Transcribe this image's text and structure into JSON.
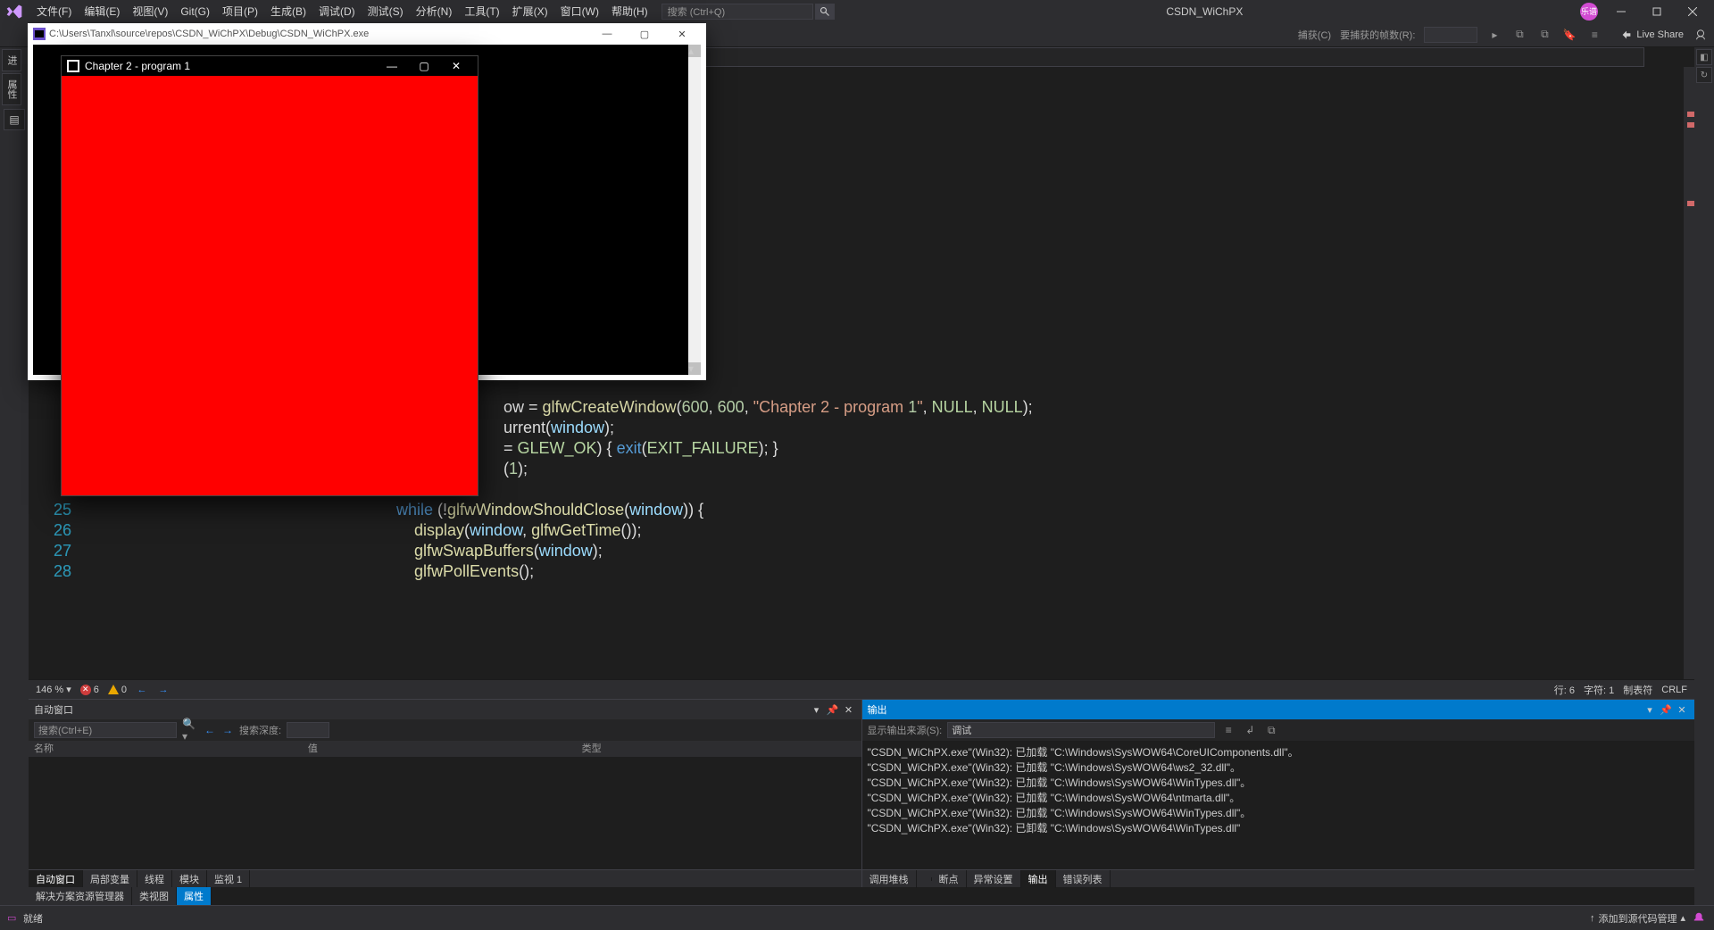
{
  "menubar": {
    "items": [
      "文件(F)",
      "编辑(E)",
      "视图(V)",
      "Git(G)",
      "项目(P)",
      "生成(B)",
      "调试(D)",
      "测试(S)",
      "分析(N)",
      "工具(T)",
      "扩展(X)",
      "窗口(W)",
      "帮助(H)"
    ],
    "search_placeholder": "搜索 (Ctrl+Q)",
    "title": "CSDN_WiChPX",
    "user_initial": "乐谱"
  },
  "toolbar": {
    "capture_label": "捕获(C)",
    "frames_label": "要捕获的帧数(R):",
    "frames_value": "",
    "liveshare": "Live Share"
  },
  "left_rail": {
    "tabs": [
      "进",
      "属性"
    ]
  },
  "editor": {
    "gutter_start": 25,
    "lines": [
      {
        "n": "",
        "raw": "ow = glfwCreateWindow(600, 600, \"Chapter 2 - program 1\", NULL, NULL);"
      },
      {
        "n": "",
        "raw": "urrent(window);"
      },
      {
        "n": "",
        "raw": "= GLEW_OK) { exit(EXIT_FAILURE); }"
      },
      {
        "n": "",
        "raw": "(1);"
      },
      {
        "n": "",
        "raw": ""
      },
      {
        "n": 25,
        "raw": "while (!glfwWindowShouldClose(window)) {"
      },
      {
        "n": 26,
        "raw": "    display(window, glfwGetTime());"
      },
      {
        "n": 27,
        "raw": "    glfwSwapBuffers(window);"
      },
      {
        "n": 28,
        "raw": "    glfwPollEvents();"
      }
    ],
    "status": {
      "zoom": "146 %",
      "errors": "6",
      "warnings": "0",
      "line": "行: 6",
      "col": "字符: 1",
      "tab": "制表符",
      "eol": "CRLF"
    }
  },
  "autos": {
    "title": "自动窗口",
    "search_placeholder": "搜索(Ctrl+E)",
    "depth_label": "搜索深度:",
    "cols": [
      "名称",
      "值",
      "类型"
    ],
    "tabs": [
      "自动窗口",
      "局部变量",
      "线程",
      "模块",
      "监视 1"
    ]
  },
  "output": {
    "title": "输出",
    "src_label": "显示输出来源(S):",
    "src_value": "调试",
    "lines": [
      "\"CSDN_WiChPX.exe\"(Win32): 已加载 \"C:\\Windows\\SysWOW64\\CoreUIComponents.dll\"。",
      "\"CSDN_WiChPX.exe\"(Win32): 已加载 \"C:\\Windows\\SysWOW64\\ws2_32.dll\"。",
      "\"CSDN_WiChPX.exe\"(Win32): 已加载 \"C:\\Windows\\SysWOW64\\WinTypes.dll\"。",
      "\"CSDN_WiChPX.exe\"(Win32): 已加载 \"C:\\Windows\\SysWOW64\\ntmarta.dll\"。",
      "\"CSDN_WiChPX.exe\"(Win32): 已加载 \"C:\\Windows\\SysWOW64\\WinTypes.dll\"。",
      "\"CSDN_WiChPX.exe\"(Win32): 已卸载 \"C:\\Windows\\SysWOW64\\WinTypes.dll\""
    ],
    "tabs": [
      "调用堆栈",
      "断点",
      "异常设置",
      "输出",
      "错误列表"
    ]
  },
  "side_tabs": [
    "解决方案资源管理器",
    "类视图",
    "属性"
  ],
  "statusbar": {
    "ready": "就绪",
    "add_src": "添加到源代码管理"
  },
  "console": {
    "title": "C:\\Users\\Tanxl\\source\\repos\\CSDN_WiChPX\\Debug\\CSDN_WiChPX.exe"
  },
  "glwin": {
    "title": "Chapter 2 - program 1"
  }
}
